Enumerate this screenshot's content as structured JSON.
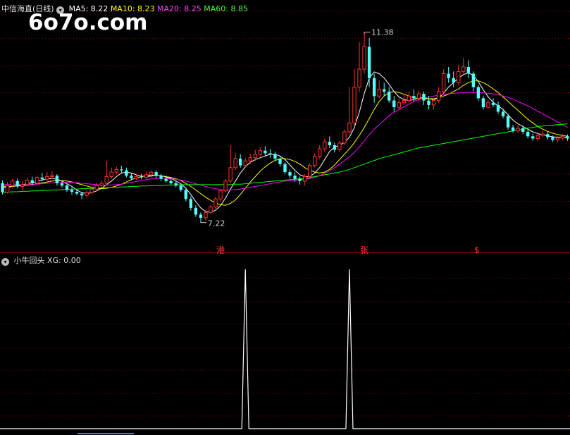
{
  "watermark": "6o7o.com",
  "colors": {
    "up": "#ff3232",
    "down": "#54ffff",
    "ma5": "#ffffff",
    "ma10": "#ffff00",
    "ma20": "#ff00ff",
    "ma60": "#00ff00",
    "grid": "#8b0000",
    "bg": "#000000"
  },
  "main_header": {
    "title": "中信海直(日线)",
    "ma5": "MA5: 8.22",
    "ma10": "MA10: 8.23",
    "ma20": "MA20: 8.25",
    "ma60": "MA60: 8.85"
  },
  "sub_header": {
    "title": "小牛回头",
    "value": "XG: 0.00"
  },
  "chart_data": [
    {
      "type": "candlestick",
      "title": "中信海直(日线)",
      "ylim": [
        6.6,
        11.8
      ],
      "annotations": {
        "max_label": "11.38",
        "min_label": "7.22"
      },
      "markers": [
        "港",
        "张",
        "$"
      ],
      "candles": [
        [
          8.05,
          7.85,
          8.12,
          7.8
        ],
        [
          7.85,
          8.0,
          8.08,
          7.82
        ],
        [
          8.0,
          8.1,
          8.15,
          7.95
        ],
        [
          8.1,
          7.98,
          8.16,
          7.94
        ],
        [
          7.98,
          8.02,
          8.1,
          7.92
        ],
        [
          8.02,
          8.12,
          8.18,
          7.98
        ],
        [
          8.12,
          8.05,
          8.2,
          8.0
        ],
        [
          8.05,
          8.18,
          8.22,
          8.02
        ],
        [
          8.18,
          8.14,
          8.28,
          8.1
        ],
        [
          8.14,
          8.2,
          8.3,
          8.1
        ],
        [
          8.2,
          8.22,
          8.32,
          8.15
        ],
        [
          8.22,
          8.05,
          8.25,
          8.0
        ],
        [
          8.05,
          8.0,
          8.12,
          7.95
        ],
        [
          8.0,
          7.9,
          8.05,
          7.86
        ],
        [
          7.9,
          7.86,
          7.96,
          7.8
        ],
        [
          7.86,
          7.82,
          7.92,
          7.78
        ],
        [
          7.82,
          7.78,
          7.86,
          7.7
        ],
        [
          7.78,
          7.84,
          7.9,
          7.74
        ],
        [
          7.84,
          7.92,
          7.98,
          7.8
        ],
        [
          7.92,
          8.0,
          8.06,
          7.88
        ],
        [
          8.0,
          8.05,
          8.12,
          7.96
        ],
        [
          8.05,
          8.2,
          8.55,
          8.0
        ],
        [
          8.2,
          8.3,
          8.4,
          8.15
        ],
        [
          8.3,
          8.36,
          8.42,
          8.25
        ],
        [
          8.36,
          8.34,
          8.44,
          8.28
        ],
        [
          8.34,
          8.22,
          8.4,
          8.18
        ],
        [
          8.22,
          8.16,
          8.28,
          8.12
        ],
        [
          8.16,
          8.2,
          8.26,
          8.12
        ],
        [
          8.2,
          8.18,
          8.26,
          8.14
        ],
        [
          8.18,
          8.24,
          8.3,
          8.14
        ],
        [
          8.24,
          8.3,
          8.34,
          8.18
        ],
        [
          8.3,
          8.22,
          8.34,
          8.16
        ],
        [
          8.22,
          8.15,
          8.26,
          8.1
        ],
        [
          8.15,
          8.1,
          8.22,
          8.06
        ],
        [
          8.1,
          8.05,
          8.16,
          8.02
        ],
        [
          8.05,
          8.0,
          8.1,
          7.96
        ],
        [
          8.0,
          7.9,
          8.05,
          7.86
        ],
        [
          7.9,
          7.7,
          7.95,
          7.65
        ],
        [
          7.7,
          7.5,
          7.76,
          7.44
        ],
        [
          7.5,
          7.35,
          7.56,
          7.3
        ],
        [
          7.35,
          7.28,
          7.4,
          7.22
        ],
        [
          7.28,
          7.4,
          7.45,
          7.22
        ],
        [
          7.4,
          7.52,
          7.58,
          7.36
        ],
        [
          7.52,
          7.7,
          7.75,
          7.48
        ],
        [
          7.7,
          7.88,
          7.92,
          7.65
        ],
        [
          7.88,
          8.1,
          8.15,
          7.85
        ],
        [
          8.1,
          8.4,
          8.9,
          8.05
        ],
        [
          8.4,
          8.6,
          8.72,
          8.35
        ],
        [
          8.6,
          8.45,
          8.7,
          8.4
        ],
        [
          8.45,
          8.55,
          8.62,
          8.4
        ],
        [
          8.55,
          8.62,
          8.7,
          8.48
        ],
        [
          8.62,
          8.7,
          8.8,
          8.55
        ],
        [
          8.7,
          8.78,
          8.85,
          8.65
        ],
        [
          8.78,
          8.72,
          8.88,
          8.66
        ],
        [
          8.72,
          8.7,
          8.82,
          8.62
        ],
        [
          8.7,
          8.6,
          8.76,
          8.55
        ],
        [
          8.6,
          8.48,
          8.65,
          8.42
        ],
        [
          8.48,
          8.3,
          8.52,
          8.25
        ],
        [
          8.3,
          8.22,
          8.36,
          8.16
        ],
        [
          8.22,
          8.15,
          8.3,
          8.08
        ],
        [
          8.15,
          8.1,
          8.2,
          8.02
        ],
        [
          8.1,
          8.2,
          8.25,
          8.0
        ],
        [
          8.2,
          8.45,
          8.5,
          8.15
        ],
        [
          8.45,
          8.65,
          8.72,
          8.4
        ],
        [
          8.65,
          8.82,
          8.9,
          8.6
        ],
        [
          8.82,
          8.98,
          9.05,
          8.76
        ],
        [
          8.98,
          8.9,
          9.1,
          8.84
        ],
        [
          8.9,
          8.8,
          8.96,
          8.74
        ],
        [
          8.8,
          8.95,
          9.0,
          8.75
        ],
        [
          8.95,
          9.2,
          9.25,
          8.9
        ],
        [
          9.2,
          9.4,
          10.2,
          9.15
        ],
        [
          9.4,
          10.2,
          10.6,
          9.35
        ],
        [
          10.2,
          10.6,
          11.2,
          10.1
        ],
        [
          10.6,
          11.1,
          11.38,
          10.5
        ],
        [
          11.1,
          10.4,
          11.3,
          10.2
        ],
        [
          10.4,
          10.0,
          10.5,
          9.85
        ],
        [
          10.0,
          10.15,
          10.35,
          9.95
        ],
        [
          10.15,
          10.1,
          10.3,
          10.0
        ],
        [
          10.1,
          9.9,
          10.2,
          9.85
        ],
        [
          9.9,
          9.75,
          10.0,
          9.65
        ],
        [
          9.75,
          9.85,
          9.95,
          9.7
        ],
        [
          9.85,
          9.9,
          10.05,
          9.8
        ],
        [
          9.9,
          10.0,
          10.1,
          9.85
        ],
        [
          10.0,
          9.95,
          10.15,
          9.88
        ],
        [
          9.95,
          10.05,
          10.12,
          9.9
        ],
        [
          10.05,
          9.9,
          10.1,
          9.8
        ],
        [
          9.9,
          9.8,
          10.0,
          9.7
        ],
        [
          9.8,
          9.9,
          9.95,
          9.7
        ],
        [
          9.9,
          10.1,
          10.2,
          9.85
        ],
        [
          10.1,
          10.5,
          10.6,
          10.05
        ],
        [
          10.5,
          10.4,
          10.65,
          10.3
        ],
        [
          10.4,
          10.3,
          10.55,
          10.2
        ],
        [
          10.3,
          10.55,
          10.7,
          10.25
        ],
        [
          10.55,
          10.65,
          10.85,
          10.5
        ],
        [
          10.65,
          10.5,
          10.8,
          10.4
        ],
        [
          10.5,
          10.2,
          10.55,
          10.1
        ],
        [
          10.2,
          9.95,
          10.25,
          9.9
        ],
        [
          9.95,
          9.75,
          10.0,
          9.7
        ],
        [
          9.75,
          9.85,
          9.92,
          9.72
        ],
        [
          9.85,
          9.8,
          9.95,
          9.75
        ],
        [
          9.8,
          9.65,
          9.88,
          9.6
        ],
        [
          9.65,
          9.55,
          9.72,
          9.5
        ],
        [
          9.55,
          9.3,
          9.6,
          9.25
        ],
        [
          9.3,
          9.22,
          9.36,
          9.18
        ],
        [
          9.22,
          9.28,
          9.35,
          9.18
        ],
        [
          9.28,
          9.2,
          9.34,
          9.15
        ],
        [
          9.2,
          9.1,
          9.25,
          9.05
        ],
        [
          9.1,
          9.05,
          9.16,
          9.0
        ],
        [
          9.05,
          9.12,
          9.18,
          9.0
        ],
        [
          9.12,
          9.15,
          9.22,
          9.08
        ],
        [
          9.15,
          9.08,
          9.2,
          9.02
        ],
        [
          9.08,
          9.02,
          9.12,
          8.98
        ],
        [
          9.02,
          9.06,
          9.1,
          8.98
        ],
        [
          9.06,
          9.1,
          9.15,
          9.02
        ],
        [
          9.1,
          9.05,
          9.14,
          9.0
        ]
      ],
      "series": [
        {
          "name": "MA5",
          "values": [
            7.95,
            7.96,
            7.98,
            8.0,
            8.02,
            8.04,
            8.06,
            8.09,
            8.12,
            8.15,
            8.16,
            8.14,
            8.1,
            8.04,
            7.98,
            7.9,
            7.84,
            7.82,
            7.84,
            7.88,
            7.94,
            8.02,
            8.1,
            8.2,
            8.28,
            8.3,
            8.28,
            8.24,
            8.21,
            8.2,
            8.21,
            8.23,
            8.22,
            8.19,
            8.16,
            8.1,
            8.04,
            7.94,
            7.8,
            7.64,
            7.5,
            7.42,
            7.4,
            7.45,
            7.55,
            7.72,
            7.92,
            8.1,
            8.28,
            8.42,
            8.52,
            8.58,
            8.62,
            8.66,
            8.7,
            8.7,
            8.66,
            8.58,
            8.46,
            8.34,
            8.24,
            8.2,
            8.2,
            8.28,
            8.4,
            8.58,
            8.76,
            8.86,
            8.9,
            8.96,
            9.08,
            9.3,
            9.64,
            10.06,
            10.4,
            10.54,
            10.5,
            10.4,
            10.26,
            10.1,
            9.98,
            9.92,
            9.9,
            9.92,
            9.96,
            9.96,
            9.94,
            9.92,
            9.96,
            10.06,
            10.2,
            10.3,
            10.4,
            10.48,
            10.52,
            10.46,
            10.32,
            10.14,
            9.98,
            9.86,
            9.78,
            9.7,
            9.58,
            9.46,
            9.38,
            9.32,
            9.26,
            9.2,
            9.16,
            9.13,
            9.11,
            9.09,
            9.08,
            9.08,
            9.07
          ]
        },
        {
          "name": "MA10",
          "values": [
            7.98,
            7.98,
            7.98,
            7.99,
            8.0,
            8.01,
            8.02,
            8.04,
            8.06,
            8.08,
            8.1,
            8.11,
            8.11,
            8.1,
            8.08,
            8.05,
            8.02,
            7.99,
            7.96,
            7.94,
            7.93,
            7.94,
            7.96,
            7.99,
            8.03,
            8.08,
            8.13,
            8.17,
            8.2,
            8.22,
            8.23,
            8.23,
            8.22,
            8.2,
            8.18,
            8.15,
            8.11,
            8.05,
            7.98,
            7.9,
            7.82,
            7.74,
            7.67,
            7.61,
            7.57,
            7.56,
            7.6,
            7.68,
            7.8,
            7.94,
            8.08,
            8.2,
            8.32,
            8.42,
            8.5,
            8.56,
            8.6,
            8.6,
            8.58,
            8.54,
            8.48,
            8.4,
            8.34,
            8.3,
            8.28,
            8.3,
            8.36,
            8.46,
            8.58,
            8.7,
            8.82,
            8.96,
            9.12,
            9.3,
            9.5,
            9.7,
            9.88,
            10.0,
            10.08,
            10.1,
            10.08,
            10.04,
            10.0,
            9.96,
            9.94,
            9.94,
            9.94,
            9.94,
            9.96,
            10.0,
            10.04,
            10.1,
            10.16,
            10.24,
            10.3,
            10.34,
            10.34,
            10.3,
            10.24,
            10.16,
            10.08,
            9.98,
            9.88,
            9.78,
            9.68,
            9.58,
            9.48,
            9.4,
            9.32,
            9.26,
            9.21,
            9.17,
            9.14,
            9.12,
            9.1
          ]
        },
        {
          "name": "MA20",
          "values": [
            8.02,
            8.02,
            8.02,
            8.02,
            8.02,
            8.02,
            8.03,
            8.03,
            8.04,
            8.05,
            8.06,
            8.07,
            8.07,
            8.07,
            8.07,
            8.06,
            8.05,
            8.04,
            8.03,
            8.02,
            8.01,
            8.01,
            8.01,
            8.02,
            8.03,
            8.05,
            8.07,
            8.09,
            8.11,
            8.13,
            8.15,
            8.16,
            8.16,
            8.16,
            8.15,
            8.14,
            8.12,
            8.1,
            8.07,
            8.04,
            8.01,
            7.98,
            7.95,
            7.93,
            7.91,
            7.9,
            7.9,
            7.91,
            7.92,
            7.94,
            7.96,
            7.98,
            8.0,
            8.02,
            8.04,
            8.06,
            8.08,
            8.1,
            8.11,
            8.12,
            8.13,
            8.14,
            8.16,
            8.18,
            8.22,
            8.27,
            8.33,
            8.4,
            8.48,
            8.56,
            8.64,
            8.74,
            8.86,
            9.0,
            9.14,
            9.26,
            9.36,
            9.46,
            9.56,
            9.64,
            9.7,
            9.76,
            9.82,
            9.88,
            9.92,
            9.96,
            9.98,
            10.0,
            10.02,
            10.04,
            10.05,
            10.06,
            10.07,
            10.08,
            10.08,
            10.08,
            10.08,
            10.07,
            10.06,
            10.05,
            10.03,
            10.0,
            9.97,
            9.93,
            9.88,
            9.83,
            9.78,
            9.72,
            9.66,
            9.6,
            9.54,
            9.48,
            9.42,
            9.36,
            9.3
          ]
        },
        {
          "name": "MA60",
          "values": [
            7.85,
            7.85,
            7.86,
            7.86,
            7.87,
            7.87,
            7.88,
            7.88,
            7.89,
            7.89,
            7.9,
            7.9,
            7.91,
            7.91,
            7.92,
            7.92,
            7.93,
            7.93,
            7.94,
            7.94,
            7.95,
            7.95,
            7.96,
            7.96,
            7.97,
            7.97,
            7.98,
            7.98,
            7.99,
            7.99,
            8.0,
            8.0,
            8.0,
            8.01,
            8.01,
            8.01,
            8.02,
            8.02,
            8.02,
            8.02,
            8.02,
            8.02,
            8.02,
            8.02,
            8.02,
            8.02,
            8.02,
            8.03,
            8.03,
            8.04,
            8.05,
            8.06,
            8.07,
            8.08,
            8.09,
            8.1,
            8.11,
            8.12,
            8.13,
            8.14,
            8.15,
            8.16,
            8.18,
            8.2,
            8.22,
            8.24,
            8.26,
            8.28,
            8.3,
            8.33,
            8.36,
            8.4,
            8.44,
            8.48,
            8.52,
            8.56,
            8.6,
            8.63,
            8.66,
            8.69,
            8.72,
            8.75,
            8.78,
            8.81,
            8.84,
            8.86,
            8.88,
            8.9,
            8.92,
            8.94,
            8.96,
            8.98,
            9.0,
            9.02,
            9.04,
            9.06,
            9.08,
            9.1,
            9.12,
            9.14,
            9.16,
            9.18,
            9.2,
            9.22,
            9.24,
            9.26,
            9.28,
            9.3,
            9.32,
            9.33,
            9.34,
            9.35,
            9.36,
            9.37,
            9.38
          ]
        }
      ]
    },
    {
      "type": "line",
      "title": "小牛回头",
      "series": [
        {
          "name": "XG",
          "spike_indices": [
            49,
            70
          ]
        }
      ],
      "ylim": [
        0,
        1
      ],
      "current": 0.0
    }
  ]
}
